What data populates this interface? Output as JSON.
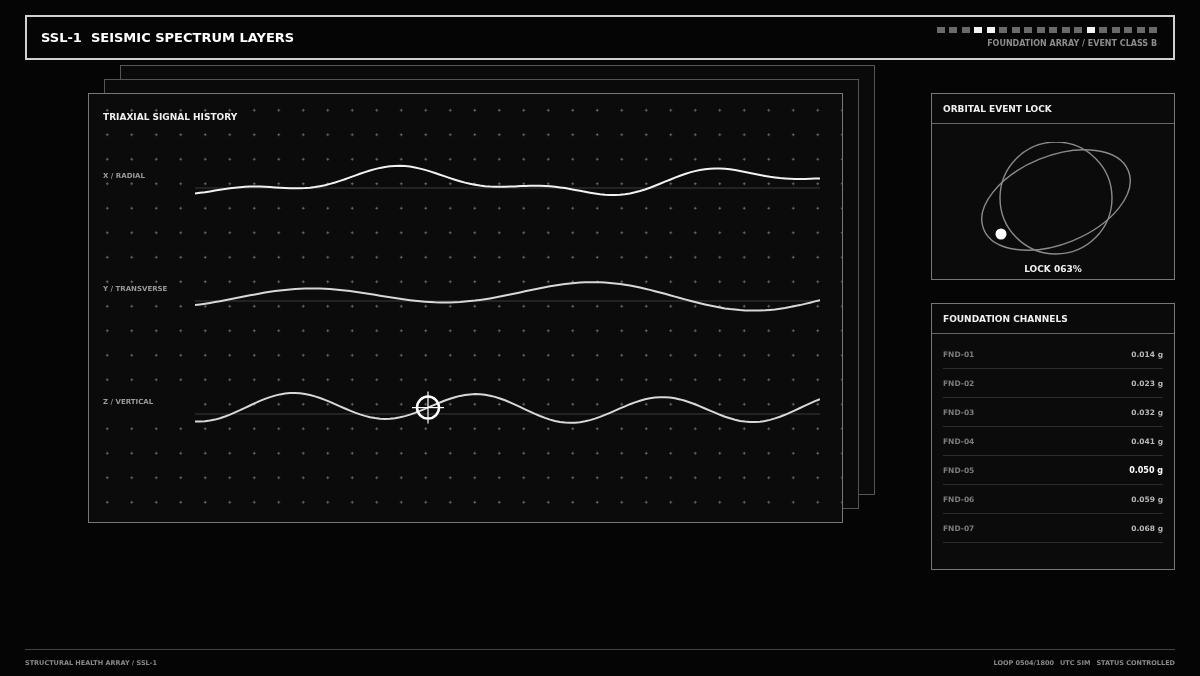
{
  "header": {
    "title": "SSL-1  SEISMIC SPECTRUM LAYERS",
    "subtitle": "FOUNDATION ARRAY / EVENT CLASS B",
    "segments": [
      {
        "on": false
      },
      {
        "on": false
      },
      {
        "on": false
      },
      {
        "on": true
      },
      {
        "on": true
      },
      {
        "on": false
      },
      {
        "on": false
      },
      {
        "on": false
      },
      {
        "on": false
      },
      {
        "on": false
      },
      {
        "on": false
      },
      {
        "on": false
      },
      {
        "on": true
      },
      {
        "on": false
      },
      {
        "on": false
      },
      {
        "on": false
      },
      {
        "on": false
      },
      {
        "on": false
      }
    ]
  },
  "signal_history": {
    "title": "TRIAXIAL SIGNAL HISTORY",
    "axes": [
      {
        "label": "X / RADIAL",
        "cursor": false
      },
      {
        "label": "Y / TRANSVERSE",
        "cursor": false
      },
      {
        "label": "Z / VERTICAL",
        "cursor": true
      }
    ]
  },
  "orbital_lock": {
    "title": "ORBITAL EVENT LOCK",
    "reading": "LOCK 063%"
  },
  "foundation_channels": {
    "title": "FOUNDATION CHANNELS",
    "rows": [
      {
        "label": "FND-01",
        "value": "0.014 g",
        "selected": false
      },
      {
        "label": "FND-02",
        "value": "0.023 g",
        "selected": false
      },
      {
        "label": "FND-03",
        "value": "0.032 g",
        "selected": false
      },
      {
        "label": "FND-04",
        "value": "0.041 g",
        "selected": false
      },
      {
        "label": "FND-05",
        "value": "0.050 g",
        "selected": true
      },
      {
        "label": "FND-06",
        "value": "0.059 g",
        "selected": false
      },
      {
        "label": "FND-07",
        "value": "0.068 g",
        "selected": false
      }
    ]
  },
  "footer": {
    "left": "STRUCTURAL HEALTH ARRAY / SSL-1",
    "right": [
      "LOOP 0504/1800",
      "UTC SIM",
      "STATUS CONTROLLED"
    ]
  }
}
